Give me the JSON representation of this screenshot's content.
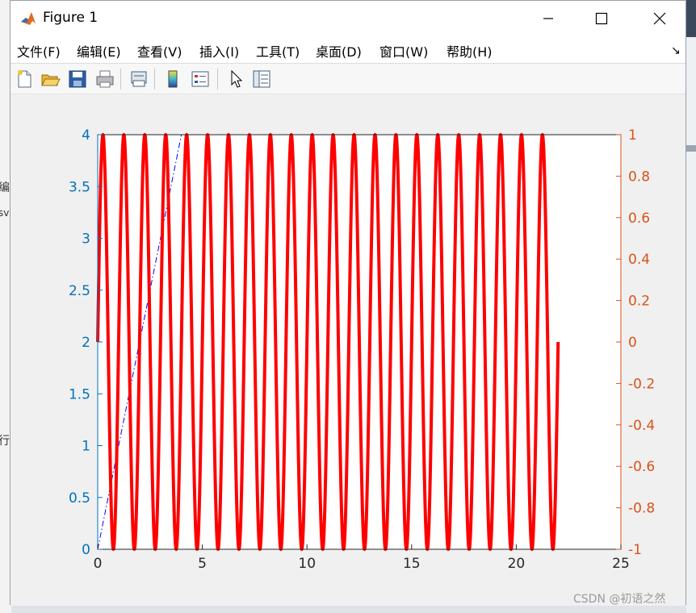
{
  "window": {
    "title": "Figure 1",
    "minimize_glyph": "—",
    "maximize_glyph": "☐",
    "close_glyph": "✕"
  },
  "menu": {
    "items": [
      "文件(F)",
      "编辑(E)",
      "查看(V)",
      "插入(I)",
      "工具(T)",
      "桌面(D)",
      "窗口(W)",
      "帮助(H)"
    ],
    "dock_glyph": "↘"
  },
  "toolbar": {
    "icons": [
      "new-figure-icon",
      "open-file-icon",
      "save-icon",
      "print-icon",
      "print-preview-icon",
      "insert-colorbar-icon",
      "insert-legend-icon",
      "edit-plot-arrow-icon",
      "property-inspector-icon"
    ]
  },
  "background_fragments": [
    "编",
    "sv",
    "行"
  ],
  "colors": {
    "left_axis": "#0072bd",
    "right_axis": "#d95319",
    "sine_series": "#ff0000",
    "line_series": "#0000ff"
  },
  "watermark": "CSDN @初语之然",
  "chart_data": {
    "type": "line",
    "x_range": [
      0,
      25
    ],
    "x_ticks": [
      "0",
      "5",
      "10",
      "15",
      "20",
      "25"
    ],
    "y_left_range": [
      0,
      4
    ],
    "y_left_ticks": [
      "0",
      "0.5",
      "1",
      "1.5",
      "2",
      "2.5",
      "3",
      "3.5",
      "4"
    ],
    "y_right_range": [
      -1,
      1
    ],
    "y_right_ticks": [
      "-1",
      "-0.8",
      "-0.6",
      "-0.4",
      "-0.2",
      "0",
      "0.2",
      "0.4",
      "0.6",
      "0.8",
      "1"
    ],
    "grid": false,
    "legend": "none",
    "series": [
      {
        "axis": "left",
        "style": "dash-dot",
        "color": "#0000ff",
        "x": [
          0,
          4
        ],
        "y": [
          0,
          4
        ]
      },
      {
        "axis": "right",
        "style": "solid-thick",
        "color": "#ff0000",
        "function": "sin(2*pi*x)",
        "x_start": 0,
        "x_end": 22
      }
    ]
  }
}
